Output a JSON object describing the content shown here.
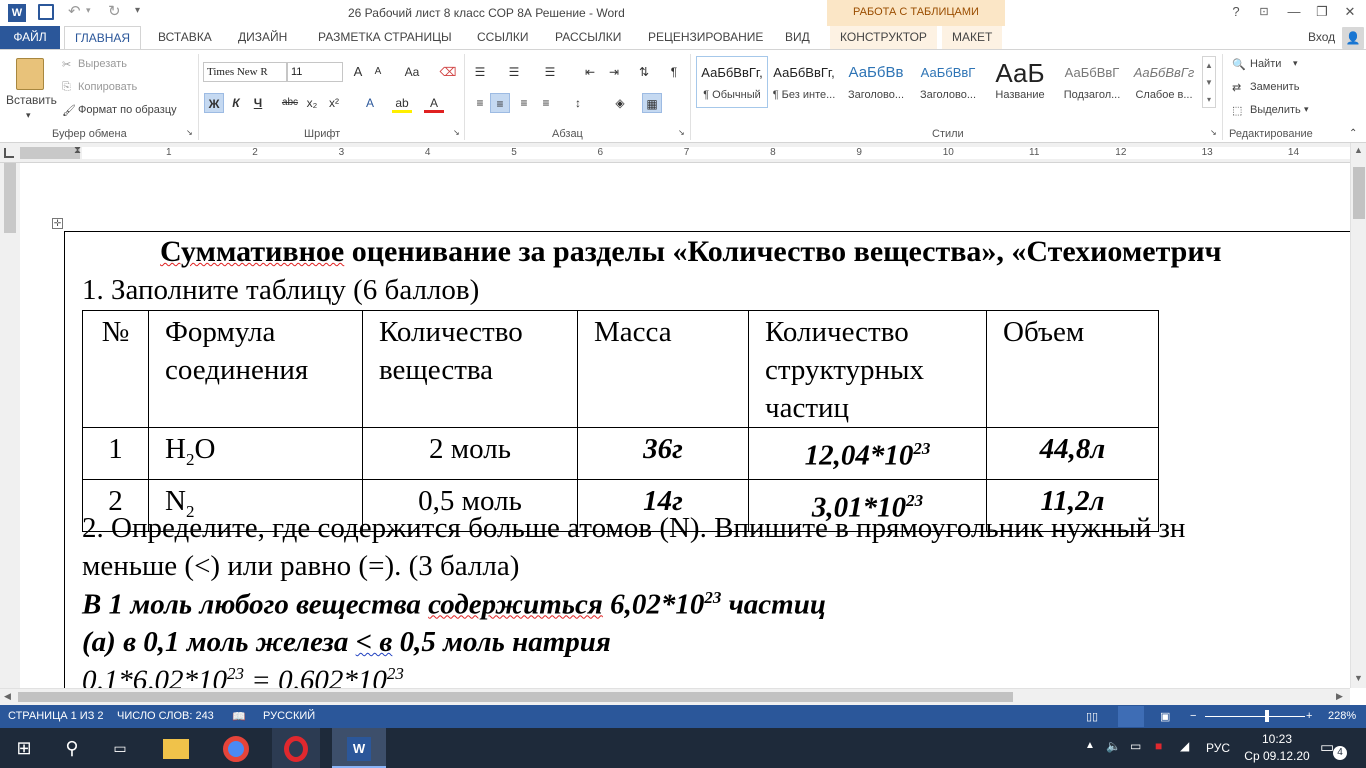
{
  "titlebar": {
    "title": "26 Рабочий лист 8 класс СОР 8А Решение - Word",
    "context_group": "РАБОТА С ТАБЛИЦАМИ",
    "help": "?",
    "minimize": "—",
    "restore": "❐",
    "close": "✕"
  },
  "tabs": {
    "file": "ФАЙЛ",
    "home": "ГЛАВНАЯ",
    "insert": "ВСТАВКА",
    "design": "ДИЗАЙН",
    "layout": "РАЗМЕТКА СТРАНИЦЫ",
    "references": "ССЫЛКИ",
    "mailings": "РАССЫЛКИ",
    "review": "РЕЦЕНЗИРОВАНИЕ",
    "view": "ВИД",
    "constructor": "КОНСТРУКТОР",
    "table_layout": "МАКЕТ",
    "signin": "Вход"
  },
  "clipboard": {
    "paste": "Вставить",
    "cut": "Вырезать",
    "copy": "Копировать",
    "format_painter": "Формат по образцу",
    "label": "Буфер обмена"
  },
  "font": {
    "name": "Times New R",
    "size": "11",
    "label": "Шрифт",
    "bold": "Ж",
    "italic": "К",
    "underline": "Ч",
    "strike": "abc",
    "sub": "x₂",
    "sup": "x²",
    "grow": "A",
    "shrink": "A",
    "case": "Aa",
    "color_a": "A"
  },
  "paragraph": {
    "label": "Абзац"
  },
  "styles": {
    "label": "Стили",
    "items": [
      {
        "preview": "АаБбВвГг,",
        "name": "¶ Обычный"
      },
      {
        "preview": "АаБбВвГг,",
        "name": "¶ Без инте..."
      },
      {
        "preview": "АаБбВв",
        "name": "Заголово..."
      },
      {
        "preview": "АаБбВвГ",
        "name": "Заголово..."
      },
      {
        "preview": "АаБ",
        "name": "Название"
      },
      {
        "preview": "АаБбВвГ",
        "name": "Подзагол..."
      },
      {
        "preview": "АаБбВвГг",
        "name": "Слабое в..."
      }
    ]
  },
  "editing": {
    "find": "Найти",
    "replace": "Заменить",
    "select": "Выделить",
    "label": "Редактирование"
  },
  "ruler": {
    "numbers": [
      "1",
      "2",
      "3",
      "4",
      "5",
      "6",
      "7",
      "8",
      "9",
      "10",
      "11",
      "12",
      "13",
      "14"
    ]
  },
  "document": {
    "heading": "Суммативное оценивание за разделы «Количество вещества», «Стехиометрич",
    "q1": "1. Заполните таблицу (6 баллов)",
    "table": {
      "headers": [
        "№",
        "Формула соединения",
        "Количество вещества",
        "Масса",
        "Количество структурных частиц",
        "Объем"
      ],
      "h_num": "№",
      "h_formula_1": "Формула",
      "h_formula_2": "соединения",
      "h_amount_1": "Количество",
      "h_amount_2": "вещества",
      "h_mass": "Масса",
      "h_particles_1": "Количество",
      "h_particles_2": "структурных",
      "h_particles_3": "частиц",
      "h_volume": "Объем",
      "rows": [
        {
          "n": "1",
          "formula_a": "H",
          "formula_sub": "2",
          "formula_b": "O",
          "amount": "2 моль",
          "mass": "36г",
          "particles_base": "12,04*10",
          "particles_exp": "23",
          "volume": "44,8л"
        },
        {
          "n": "2",
          "formula_a": "N",
          "formula_sub": "2",
          "formula_b": "",
          "amount": "0,5 моль",
          "mass": "14г",
          "particles_base": "3,01*10",
          "particles_exp": "23",
          "volume": "11,2л"
        }
      ]
    },
    "q2_line1": "2. Определите, где содержится больше атомов (N). Впишите в прямоугольник нужный зн",
    "q2_line2": "меньше (<) или равно (=). (3 балла)",
    "ans1_a": "В 1 моль любого вещества ",
    "ans1_b": "содержиться",
    "ans1_c": " 6,02*10",
    "ans1_exp": "23",
    "ans1_d": " частиц",
    "ans2_a": "(а) в 0,1 моль железа ",
    "ans2_b": "< в",
    "ans2_c": " 0,5 моль натрия",
    "ans3_a": "0,1*6,02*10",
    "ans3_exp1": "23",
    "ans3_b": " = 0,602*10",
    "ans3_exp2": "23"
  },
  "status": {
    "page": "СТРАНИЦА 1 ИЗ 2",
    "words": "ЧИСЛО СЛОВ: 243",
    "language": "РУССКИЙ",
    "zoom": "228%"
  },
  "taskbar": {
    "lang": "РУС",
    "time": "10:23",
    "date": "Ср 09.12.20",
    "notifications": "4"
  },
  "colors": {
    "word_blue": "#2b579a",
    "context_orange": "#fbe6c6",
    "taskbar": "#1e2a3a"
  }
}
